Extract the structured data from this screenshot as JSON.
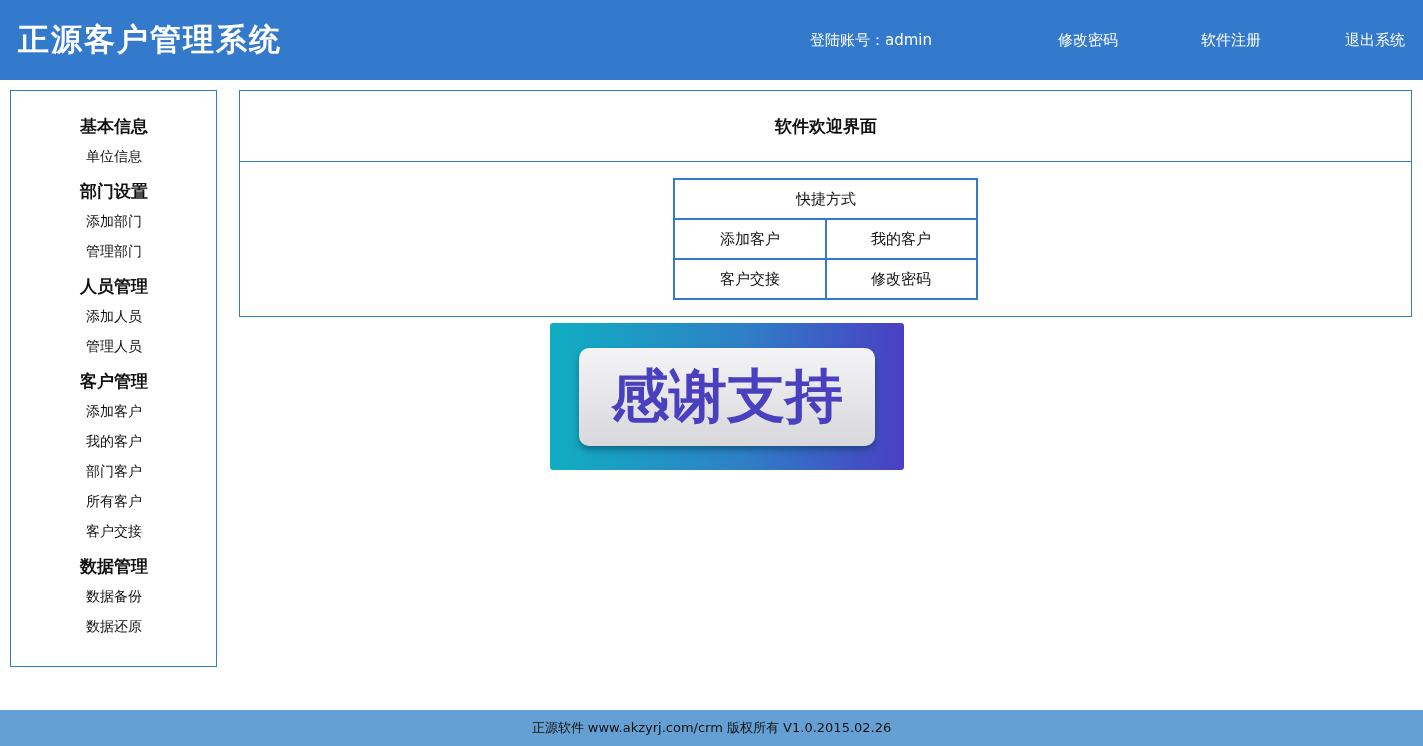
{
  "header": {
    "title": "正源客户管理系统",
    "account": "登陆账号：admin",
    "links": [
      "修改密码",
      "软件注册",
      "退出系统"
    ]
  },
  "sidebar": {
    "groups": [
      {
        "title": "基本信息",
        "items": [
          "单位信息"
        ]
      },
      {
        "title": "部门设置",
        "items": [
          "添加部门",
          "管理部门"
        ]
      },
      {
        "title": "人员管理",
        "items": [
          "添加人员",
          "管理人员"
        ]
      },
      {
        "title": "客户管理",
        "items": [
          "添加客户",
          "我的客户",
          "部门客户",
          "所有客户",
          "客户交接"
        ]
      },
      {
        "title": "数据管理",
        "items": [
          "数据备份",
          "数据还原"
        ]
      }
    ]
  },
  "welcome": {
    "title": "软件欢迎界面",
    "shortcuts": {
      "title": "快捷方式",
      "rows": [
        [
          "添加客户",
          "我的客户"
        ],
        [
          "客户交接",
          "修改密码"
        ]
      ]
    }
  },
  "banner": {
    "text": "感谢支持"
  },
  "footer": {
    "text": "正源软件 www.akzyrj.com/crm 版权所有 V1.0.2015.02.26"
  }
}
